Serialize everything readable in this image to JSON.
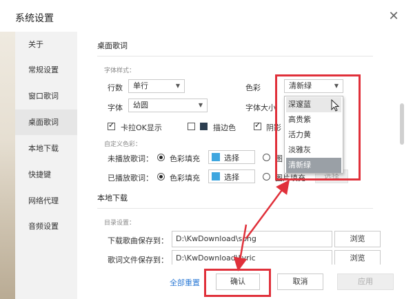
{
  "window": {
    "title": "系统设置",
    "close_glyph": "✕"
  },
  "sidebar": {
    "items": [
      {
        "label": "关于",
        "active": false
      },
      {
        "label": "常规设置",
        "active": false
      },
      {
        "label": "窗口歌词",
        "active": false
      },
      {
        "label": "桌面歌词",
        "active": true
      },
      {
        "label": "本地下载",
        "active": false
      },
      {
        "label": "快捷键",
        "active": false
      },
      {
        "label": "网络代理",
        "active": false
      },
      {
        "label": "音频设置",
        "active": false
      }
    ]
  },
  "desktop_lyrics": {
    "section_title": "桌面歌词",
    "font_style_hint": "字体样式：",
    "lines_label": "行数",
    "lines_value": "单行",
    "color_label": "色彩",
    "color_value": "清新绿",
    "font_label": "字体",
    "font_value": "幼圆",
    "font_size_label": "字体大小",
    "karaoke_label": "卡拉OK显示",
    "karaoke_checked": true,
    "stroke_label": "描边色",
    "stroke_checked": false,
    "shadow_label": "阴影",
    "shadow_checked": true,
    "custom_color_hint": "自定义色彩：",
    "unplayed_label": "未播放歌词：",
    "played_label": "已播放歌词：",
    "color_fill_label": "色彩填充",
    "image_fill_label": "图片填充",
    "image_fill_partial": "图",
    "select_label": "选择",
    "swatch_color": "#3ea6df"
  },
  "color_dropdown": {
    "options": [
      "深邃蓝",
      "高贵紫",
      "活力黄",
      "淡雅灰",
      "清新绿"
    ],
    "hover_index": 0,
    "selected_index": 4
  },
  "local_download": {
    "section_title": "本地下载",
    "dir_hint": "目录设置：",
    "song_label": "下载歌曲保存到：",
    "song_path": "D:\\KwDownload\\song",
    "lyric_label": "歌词文件保存到：",
    "lyric_path": "D:\\KwDownload\\Lyric",
    "browse_label": "浏览"
  },
  "footer": {
    "reset_all": "全部重置",
    "confirm": "确认",
    "cancel": "取消",
    "apply": "应用"
  },
  "colors": {
    "annotation_red": "#e0303a",
    "link_blue": "#2e7bd6",
    "dropdown_selected": "#9aa0a6"
  }
}
